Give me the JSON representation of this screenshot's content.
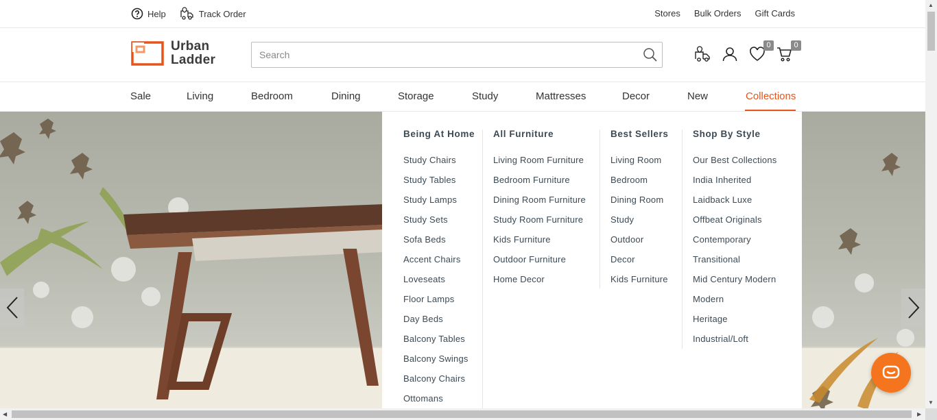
{
  "util": {
    "help": "Help",
    "track_order": "Track Order",
    "stores": "Stores",
    "bulk_orders": "Bulk Orders",
    "gift_cards": "Gift Cards"
  },
  "brand": {
    "line1": "Urban",
    "line2": "Ladder",
    "color": "#e6541c"
  },
  "search": {
    "placeholder": "Search",
    "value": ""
  },
  "header_icons": {
    "wishlist_count": "0",
    "cart_count": "0"
  },
  "nav": {
    "items": [
      "Sale",
      "Living",
      "Bedroom",
      "Dining",
      "Storage",
      "Study",
      "Mattresses",
      "Decor",
      "New",
      "Collections"
    ],
    "active": "Collections"
  },
  "mega_menu": {
    "columns": [
      {
        "title": "Being At Home",
        "items": [
          "Study Chairs",
          "Study Tables",
          "Study Lamps",
          "Study Sets",
          "Sofa Beds",
          "Accent Chairs",
          "Loveseats",
          "Floor Lamps",
          "Day Beds",
          "Balcony Tables",
          "Balcony Swings",
          "Balcony Chairs",
          "Ottomans"
        ]
      },
      {
        "title": "All Furniture",
        "items": [
          "Living Room Furniture",
          "Bedroom Furniture",
          "Dining Room Furniture",
          "Study Room Furniture",
          "Kids Furniture",
          "Outdoor Furniture",
          "Home Decor"
        ]
      },
      {
        "title": "Best Sellers",
        "items": [
          "Living Room",
          "Bedroom",
          "Dining Room",
          "Study",
          "Outdoor",
          "Decor",
          "Kids Furniture"
        ]
      },
      {
        "title": "Shop By Style",
        "items": [
          "Our Best Collections",
          "India Inherited",
          "Laidback Luxe",
          "Offbeat Originals",
          "Contemporary",
          "Transitional",
          "Mid Century Modern",
          "Modern",
          "Heritage",
          "Industrial/Loft"
        ]
      }
    ]
  },
  "colors": {
    "accent": "#e6541c",
    "menu_text": "#3b4a55",
    "chat": "#f5751f"
  }
}
